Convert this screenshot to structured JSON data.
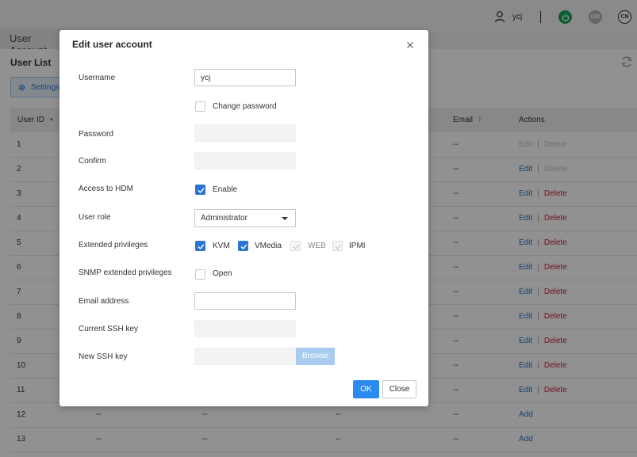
{
  "header": {
    "username": "ycj",
    "uid_label": "UID",
    "lang_label": "CN",
    "colors": {
      "power": "#1aa35a",
      "uid": "#b4b4b4"
    }
  },
  "page": {
    "tab_title": "User Account",
    "list_title": "User List",
    "settings_label": "Settings"
  },
  "table": {
    "headers": {
      "id": "User ID",
      "email": "Email",
      "actions": "Actions"
    },
    "rows": [
      {
        "id": "1",
        "c2": "",
        "c3": "",
        "c4": "",
        "email": "--",
        "edit": "Edit",
        "sep": "|",
        "delete": "Delete"
      },
      {
        "id": "2",
        "c2": "",
        "c3": "",
        "c4": "",
        "email": "--",
        "edit": "Edit",
        "sep": "|",
        "delete": "Delete"
      },
      {
        "id": "3",
        "c2": "",
        "c3": "",
        "c4": "",
        "email": "--",
        "edit": "Edit",
        "sep": "|",
        "delete": "Delete"
      },
      {
        "id": "4",
        "c2": "",
        "c3": "",
        "c4": "",
        "email": "--",
        "edit": "Edit",
        "sep": "|",
        "delete": "Delete"
      },
      {
        "id": "5",
        "c2": "",
        "c3": "",
        "c4": "",
        "email": "--",
        "edit": "Edit",
        "sep": "|",
        "delete": "Delete"
      },
      {
        "id": "6",
        "c2": "",
        "c3": "",
        "c4": "",
        "email": "--",
        "edit": "Edit",
        "sep": "|",
        "delete": "Delete"
      },
      {
        "id": "7",
        "c2": "",
        "c3": "",
        "c4": "",
        "email": "--",
        "edit": "Edit",
        "sep": "|",
        "delete": "Delete"
      },
      {
        "id": "8",
        "c2": "",
        "c3": "",
        "c4": "",
        "email": "--",
        "edit": "Edit",
        "sep": "|",
        "delete": "Delete"
      },
      {
        "id": "9",
        "c2": "",
        "c3": "",
        "c4": "",
        "email": "--",
        "edit": "Edit",
        "sep": "|",
        "delete": "Delete"
      },
      {
        "id": "10",
        "c2": "",
        "c3": "",
        "c4": "",
        "email": "--",
        "edit": "Edit",
        "sep": "|",
        "delete": "Delete"
      },
      {
        "id": "11",
        "c2": "",
        "c3": "",
        "c4": "",
        "email": "--",
        "edit": "Edit",
        "sep": "|",
        "delete": "Delete"
      },
      {
        "id": "12",
        "c2": "--",
        "c3": "--",
        "c4": "--",
        "email": "--",
        "add": "Add"
      },
      {
        "id": "13",
        "c2": "--",
        "c3": "--",
        "c4": "--",
        "email": "--",
        "add": "Add"
      }
    ]
  },
  "modal": {
    "title": "Edit user account",
    "labels": {
      "username": "Username",
      "password": "Password",
      "confirm": "Confirm",
      "hdm": "Access to HDM",
      "role": "User role",
      "extended": "Extended privileges",
      "snmp": "SNMP extended privileges",
      "email": "Email address",
      "current_ssh": "Current SSH key",
      "new_ssh": "New SSH key"
    },
    "username_value": "ycj",
    "change_password_label": "Change password",
    "hdm_enable_label": "Enable",
    "role_value": "Administrator",
    "privileges": {
      "kvm": "KVM",
      "vmedia": "VMedia",
      "web": "WEB",
      "ipmi": "IPMI"
    },
    "snmp_open_label": "Open",
    "browse_label": "Browse",
    "ok_label": "OK",
    "close_label": "Close"
  }
}
